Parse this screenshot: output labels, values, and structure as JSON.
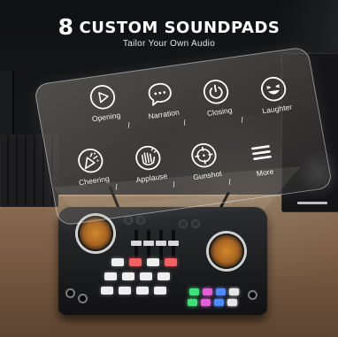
{
  "header": {
    "number": "8",
    "title": "CUSTOM SOUNDPADS",
    "subtitle": "Tailor Your Own Audio"
  },
  "soundpads": [
    {
      "label": "Opening",
      "icon": "play-icon"
    },
    {
      "label": "Narration",
      "icon": "speech-bubble-icon"
    },
    {
      "label": "Closing",
      "icon": "power-icon"
    },
    {
      "label": "Laughter",
      "icon": "laughing-face-icon"
    },
    {
      "label": "Cheering",
      "icon": "party-popper-icon"
    },
    {
      "label": "Applause",
      "icon": "clapping-hands-icon"
    },
    {
      "label": "Gunshot",
      "icon": "crosshair-icon"
    },
    {
      "label": "More",
      "icon": "menu-icon"
    }
  ],
  "separator": "/",
  "colors": {
    "text": "#ffffff",
    "jog_orange": "#d18a2c",
    "pad_green": "#3fe07a",
    "pad_magenta": "#e25fd7",
    "pad_blue": "#4f8bff",
    "pad_red": "#f06262"
  }
}
